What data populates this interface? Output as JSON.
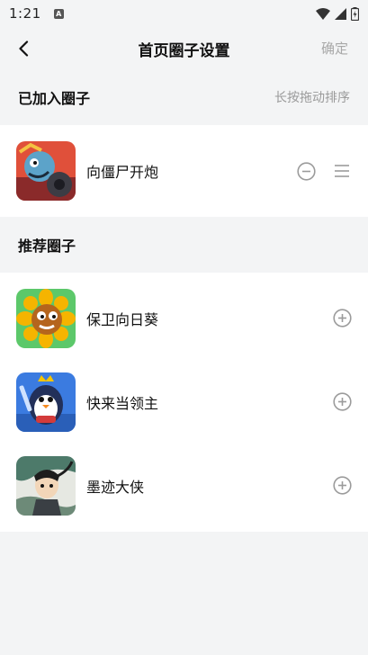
{
  "status_bar": {
    "time": "1:21",
    "notification_icon": "a-badge-icon"
  },
  "header": {
    "title": "首页圈子设置",
    "confirm_label": "确定"
  },
  "joined_section": {
    "title": "已加入圈子",
    "hint": "长按拖动排序",
    "items": [
      {
        "name": "向僵尸开炮",
        "icon": "zombie-cannon-game-icon"
      }
    ]
  },
  "recommended_section": {
    "title": "推荐圈子",
    "items": [
      {
        "name": "保卫向日葵",
        "icon": "sunflower-game-icon"
      },
      {
        "name": "快来当领主",
        "icon": "penguin-knight-game-icon"
      },
      {
        "name": "墨迹大侠",
        "icon": "ink-hero-game-icon"
      }
    ]
  },
  "colors": {
    "background": "#f3f4f5",
    "card": "#ffffff",
    "hint": "#9a9a9a",
    "icon_gray": "#9b9b9b"
  }
}
